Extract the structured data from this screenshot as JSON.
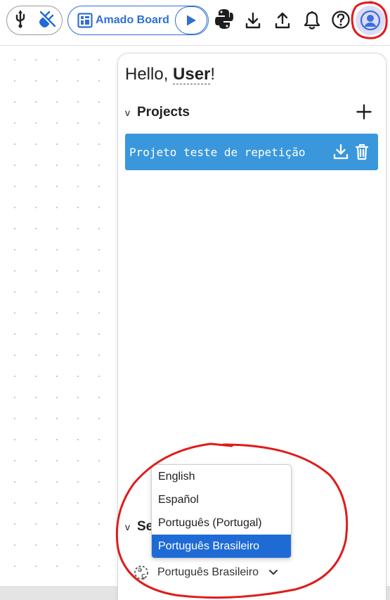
{
  "toolbar": {
    "board_name": "Amado Board",
    "icons": [
      "usb-icon",
      "plug-off-icon",
      "board-icon",
      "play-icon",
      "python-icon",
      "download-icon",
      "upload-icon",
      "bell-icon",
      "help-icon",
      "avatar-icon"
    ]
  },
  "panel": {
    "greeting_prefix": "Hello, ",
    "user_name": "User",
    "greeting_suffix": "!",
    "projects_title": "Projects",
    "projects": [
      {
        "name": "Projeto teste de repetição"
      }
    ],
    "settings_title_partial": "Se",
    "language_current": "Português Brasileiro"
  },
  "language_dropdown": {
    "options": [
      "English",
      "Español",
      "Português (Portugal)",
      "Português Brasileiro"
    ],
    "selected": "Português Brasileiro"
  },
  "colors": {
    "accent": "#2f6fd6",
    "project_card": "#3a97dc",
    "selected_option": "#1f6bd6",
    "annotation": "#e01b1b"
  }
}
